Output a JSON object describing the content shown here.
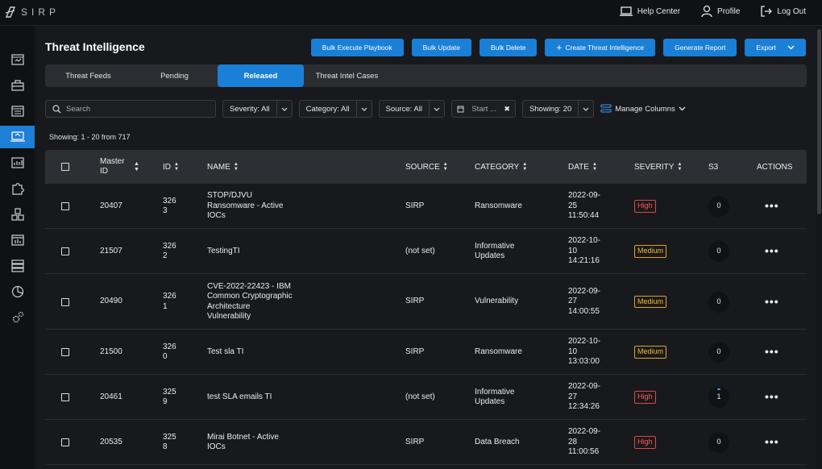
{
  "brand": {
    "logo_text": "SIRP"
  },
  "top_links": [
    {
      "label": "Help Center",
      "icon": "laptop-icon"
    },
    {
      "label": "Profile",
      "icon": "user-icon"
    },
    {
      "label": "Log Out",
      "icon": "logout-icon"
    }
  ],
  "sidebar": {
    "items": [
      {
        "icon": "dashboard-icon"
      },
      {
        "icon": "briefcase-icon"
      },
      {
        "icon": "list-icon"
      },
      {
        "icon": "threat-intel-icon",
        "active": true
      },
      {
        "icon": "reports-icon"
      },
      {
        "icon": "puzzle-icon"
      },
      {
        "icon": "cubes-icon"
      },
      {
        "icon": "chart-box-icon"
      },
      {
        "icon": "database-icon"
      },
      {
        "icon": "pie-chart-icon"
      },
      {
        "icon": "settings-icon"
      }
    ]
  },
  "page": {
    "title": "Threat Intelligence"
  },
  "toolbar": {
    "bulk_execute": "Bulk Execute Playbook",
    "bulk_update": "Bulk Update",
    "bulk_delete": "Bulk Delete",
    "create": "Create Threat Intelligence",
    "create_icon": "+",
    "generate_report": "Generate Report",
    "export": "Export"
  },
  "tabs": [
    {
      "label": "Threat Feeds"
    },
    {
      "label": "Pending"
    },
    {
      "label": "Released",
      "active": true
    },
    {
      "label": "Threat Intel Cases"
    }
  ],
  "filters": {
    "search_placeholder": "Search",
    "severity": "Severity: All",
    "category": "Category: All",
    "source": "Source: All",
    "date_placeholder": "Start ...",
    "clear_icon": "✖",
    "showing": "Showing: 20",
    "manage_columns": "Manage Columns"
  },
  "summary": {
    "showing": "Showing: 1 - 20 from 717"
  },
  "table": {
    "columns": {
      "master_id": "Master ID",
      "id": "ID",
      "name": "NAME",
      "source": "SOURCE",
      "category": "CATEGORY",
      "date": "DATE",
      "severity": "SEVERITY",
      "s3": "S3",
      "actions": "ACTIONS"
    },
    "rows": [
      {
        "master_id": "20407",
        "id": "326\n3",
        "name": "STOP/DJVU\nRansomware - Active\nIOCs",
        "source": "SIRP",
        "category": "Ransomware",
        "date": "2022-09-\n25\n11:50:44",
        "severity": "High",
        "s3": "0"
      },
      {
        "master_id": "21507",
        "id": "326\n2",
        "name": "TestingTI",
        "source": "(not set)",
        "category": "Informative\nUpdates",
        "date": "2022-10-\n10\n14:21:16",
        "severity": "Medium",
        "s3": "0"
      },
      {
        "master_id": "20490",
        "id": "326\n1",
        "name": "CVE-2022-22423 - IBM\nCommon Cryptographic\nArchitecture\nVulnerability",
        "source": "SIRP",
        "category": "Vulnerability",
        "date": "2022-09-\n27\n14:00:55",
        "severity": "Medium",
        "s3": "0"
      },
      {
        "master_id": "21500",
        "id": "326\n0",
        "name": "Test sla TI",
        "source": "SIRP",
        "category": "Ransomware",
        "date": "2022-10-\n10\n13:03:00",
        "severity": "Medium",
        "s3": "0"
      },
      {
        "master_id": "20461",
        "id": "325\n9",
        "name": "test SLA emails TI",
        "source": "(not set)",
        "category": "Informative\nUpdates",
        "date": "2022-09-\n27\n12:34:26",
        "severity": "High",
        "s3": "1"
      },
      {
        "master_id": "20535",
        "id": "325\n8",
        "name": "Mirai Botnet - Active\nIOCs",
        "source": "SIRP",
        "category": "Data Breach",
        "date": "2022-09-\n28\n11:00:56",
        "severity": "High",
        "s3": "0"
      }
    ],
    "actions_glyph": "•••"
  },
  "colors": {
    "accent": "#1a7fd6",
    "high": "#e04848",
    "medium": "#e0a52a",
    "background": "#18191d"
  }
}
